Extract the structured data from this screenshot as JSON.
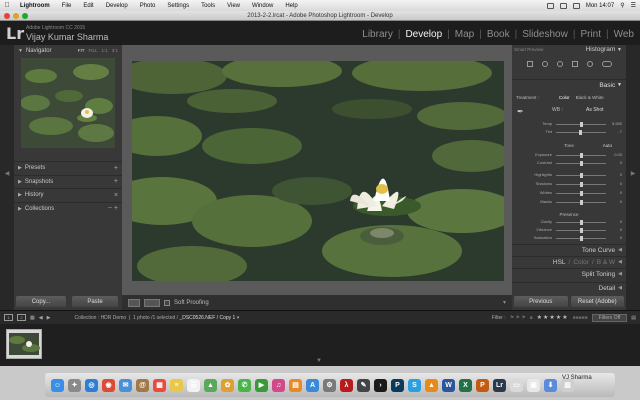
{
  "menubar": {
    "app": "Lightroom",
    "items": [
      "File",
      "Edit",
      "Develop",
      "Photo",
      "Settings",
      "Tools",
      "View",
      "Window",
      "Help"
    ],
    "clock": "Mon 14:07"
  },
  "window": {
    "title": "2013-2-2.lrcat - Adobe Photoshop Lightroom - Develop"
  },
  "identity": {
    "logo": "Lr",
    "product": "Adobe Lightroom CC 2015",
    "name": "Vijay Kumar Sharma"
  },
  "modules": [
    {
      "label": "Library",
      "active": false
    },
    {
      "label": "Develop",
      "active": true
    },
    {
      "label": "Map",
      "active": false
    },
    {
      "label": "Book",
      "active": false
    },
    {
      "label": "Slideshow",
      "active": false
    },
    {
      "label": "Print",
      "active": false
    },
    {
      "label": "Web",
      "active": false
    }
  ],
  "left_panel": {
    "navigator": {
      "label": "Navigator",
      "options": [
        "FIT",
        "FILL",
        "1:1",
        "3:1"
      ]
    },
    "sections": [
      {
        "label": "Presets",
        "action": "+"
      },
      {
        "label": "Snapshots",
        "action": "+"
      },
      {
        "label": "History",
        "action": "×"
      },
      {
        "label": "Collections",
        "action": "− +"
      }
    ],
    "buttons": {
      "copy": "Copy...",
      "paste": "Paste"
    }
  },
  "toolbar": {
    "soft_proofing": "Soft Proofing"
  },
  "right_panel": {
    "smart_preview": "Smart Preview",
    "histogram": "Histogram",
    "basic": "Basic",
    "treatment": {
      "label": "Treatment :",
      "color": "Color",
      "bw": "Black & White"
    },
    "wb": {
      "label": "WB :",
      "value": "As Shot"
    },
    "wb_sliders": [
      {
        "label": "Temp",
        "value": "5,550",
        "pos": 0.5
      },
      {
        "label": "Tint",
        "value": "- 7",
        "pos": 0.48
      }
    ],
    "tone": {
      "label": "Tone",
      "auto": "Auto"
    },
    "tone_sliders": [
      {
        "label": "Exposure",
        "value": "0.00",
        "pos": 0.5
      },
      {
        "label": "Contrast",
        "value": "0",
        "pos": 0.5
      }
    ],
    "tone2_sliders": [
      {
        "label": "Highlights",
        "value": "0",
        "pos": 0.5
      },
      {
        "label": "Shadows",
        "value": "0",
        "pos": 0.5
      },
      {
        "label": "Whites",
        "value": "0",
        "pos": 0.5
      },
      {
        "label": "Blacks",
        "value": "0",
        "pos": 0.5
      }
    ],
    "presence": "Presence",
    "presence_sliders": [
      {
        "label": "Clarity",
        "value": "0",
        "pos": 0.5
      },
      {
        "label": "Vibrance",
        "value": "0",
        "pos": 0.5
      },
      {
        "label": "Saturation",
        "value": "0",
        "pos": 0.5
      }
    ],
    "tone_curve": "Tone Curve",
    "hsl": {
      "hsl": "HSL",
      "color": "Color",
      "bw": "B & W"
    },
    "split_toning": "Split Toning",
    "detail": "Detail",
    "buttons": {
      "previous": "Previous",
      "reset": "Reset (Adobe)"
    }
  },
  "filmstrip": {
    "page1": "1",
    "page2": "2",
    "collection": "Collection : HDR Demo",
    "count": "1 photo /1 selected /",
    "filename": "_DSC0526.NEF / Copy 1",
    "filter_label": "Filter :",
    "filters_off": "Filters Off"
  },
  "dock": {
    "tooltip": "VJ Sharma",
    "apps": [
      {
        "name": "finder-icon",
        "color": "#3a8ee6",
        "glyph": "☺"
      },
      {
        "name": "launchpad-icon",
        "color": "#8a8a8a",
        "glyph": "✦"
      },
      {
        "name": "safari-icon",
        "color": "#2d7fd3",
        "glyph": "◎"
      },
      {
        "name": "chrome-icon",
        "color": "#dc4a38",
        "glyph": "◉"
      },
      {
        "name": "mail-icon",
        "color": "#4a90d9",
        "glyph": "✉"
      },
      {
        "name": "contacts-icon",
        "color": "#a0784a",
        "glyph": "@"
      },
      {
        "name": "calendar-icon",
        "color": "#e94b3c",
        "glyph": "▦"
      },
      {
        "name": "notes-icon",
        "color": "#e8c84a",
        "glyph": "≡"
      },
      {
        "name": "reminders-icon",
        "color": "#f2f2f2",
        "glyph": "☰"
      },
      {
        "name": "maps-icon",
        "color": "#5aa85a",
        "glyph": "▲"
      },
      {
        "name": "photos-icon",
        "color": "#e0a030",
        "glyph": "✿"
      },
      {
        "name": "messages-icon",
        "color": "#4ab44a",
        "glyph": "✆"
      },
      {
        "name": "facetime-icon",
        "color": "#3a9a3a",
        "glyph": "▶"
      },
      {
        "name": "itunes-icon",
        "color": "#d04a8a",
        "glyph": "♫"
      },
      {
        "name": "ibooks-icon",
        "color": "#e88a2a",
        "glyph": "▤"
      },
      {
        "name": "appstore-icon",
        "color": "#3a8ad9",
        "glyph": "A"
      },
      {
        "name": "preferences-icon",
        "color": "#7a7a7a",
        "glyph": "⚙"
      },
      {
        "name": "acrobat-icon",
        "color": "#b71c1c",
        "glyph": "λ"
      },
      {
        "name": "sketch-icon",
        "color": "#444",
        "glyph": "✎"
      },
      {
        "name": "terminal-icon",
        "color": "#1a1a1a",
        "glyph": "›"
      },
      {
        "name": "photoshop-icon",
        "color": "#0b3a5c",
        "glyph": "P"
      },
      {
        "name": "skype-icon",
        "color": "#2aa0e0",
        "glyph": "S"
      },
      {
        "name": "vlc-icon",
        "color": "#e88a1a",
        "glyph": "▲"
      },
      {
        "name": "word-icon",
        "color": "#2b579a",
        "glyph": "W"
      },
      {
        "name": "excel-icon",
        "color": "#217346",
        "glyph": "X"
      },
      {
        "name": "powerpoint-icon",
        "color": "#c55a11",
        "glyph": "P"
      },
      {
        "name": "lightroom-icon",
        "color": "#2a3a4a",
        "glyph": "Lr"
      },
      {
        "name": "documents-icon",
        "color": "#d9d9d9",
        "glyph": "▭"
      },
      {
        "name": "preview-icon",
        "color": "#e8e8e8",
        "glyph": "▣"
      },
      {
        "name": "downloads-icon",
        "color": "#5a8ad9",
        "glyph": "⬇"
      },
      {
        "name": "trash-icon",
        "color": "#cfcfcf",
        "glyph": "▥"
      }
    ]
  },
  "colors": {
    "panel": "#383838",
    "accent_text": "#f2f2f2"
  }
}
